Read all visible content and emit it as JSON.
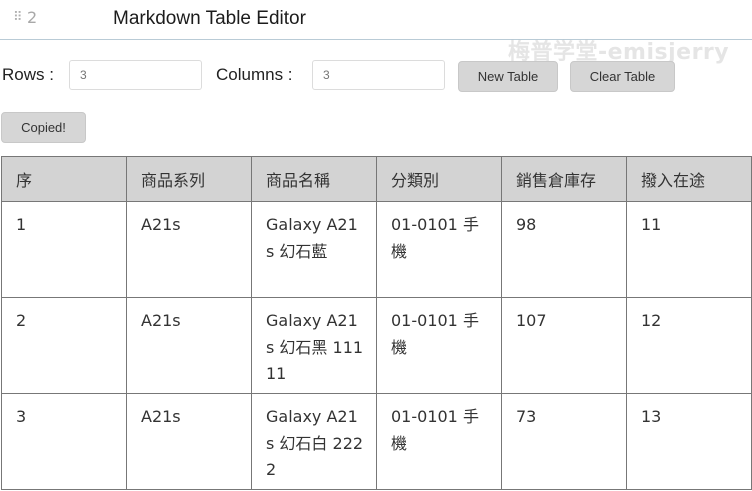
{
  "header": {
    "drag_handle": "⠿",
    "block_number": "2",
    "title": "Markdown Table Editor",
    "watermark": "梅普学堂-emisjerry"
  },
  "controls": {
    "rows_label": "Rows :",
    "rows_placeholder": "3",
    "columns_label": "Columns :",
    "columns_placeholder": "3",
    "new_table_label": "New Table",
    "clear_table_label": "Clear Table",
    "copied_label": "Copied!"
  },
  "table": {
    "headers": [
      "序",
      "商品系列",
      "商品名稱",
      "分類別",
      "銷售倉庫存",
      "撥入在途"
    ],
    "rows": [
      [
        "1",
        "A21s",
        "Galaxy A21s 幻石藍",
        "01-0101 手機",
        "98",
        "11"
      ],
      [
        "2",
        "A21s",
        "Galaxy A21s 幻石黑 11111",
        "01-0101 手機",
        "107",
        "12"
      ],
      [
        "3",
        "A21s",
        "Galaxy A21s 幻石白 2222",
        "01-0101 手機",
        "73",
        "13"
      ]
    ]
  },
  "icons": {
    "drag_handle": "drag-handle-icon"
  }
}
